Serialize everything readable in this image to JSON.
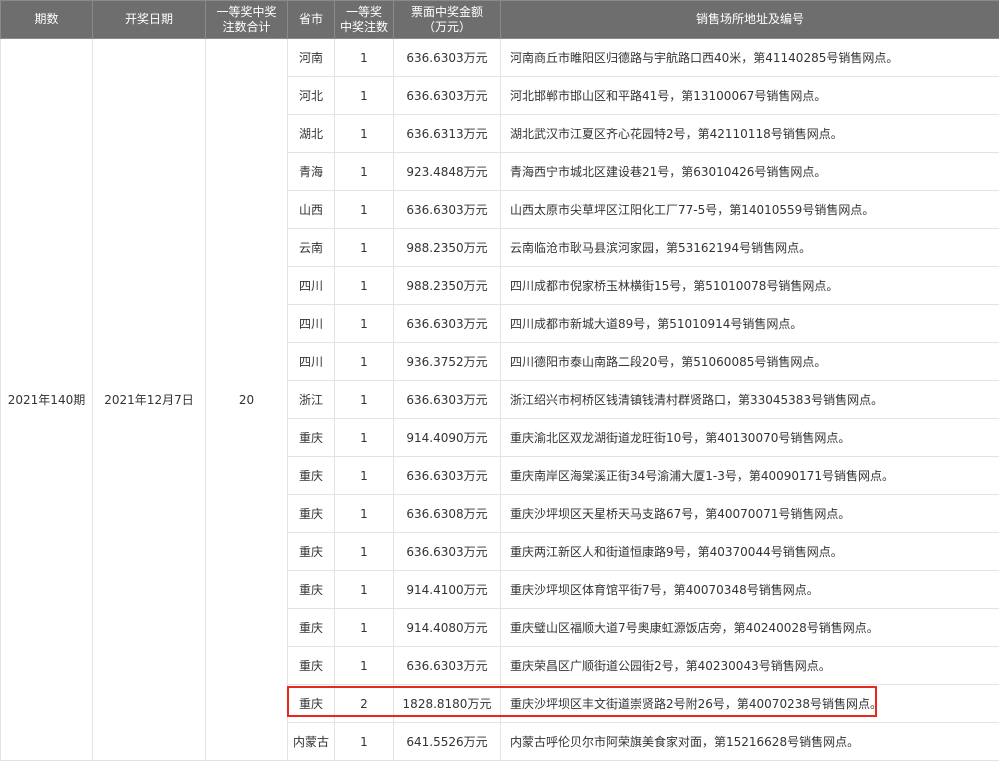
{
  "table": {
    "headers": {
      "period": "期数",
      "draw_date": "开奖日期",
      "total_first_prize_line1": "一等奖中奖",
      "total_first_prize_line2": "注数合计",
      "province": "省市",
      "first_prize_count_line1": "一等奖",
      "first_prize_count_line2": "中奖注数",
      "ticket_amount_line1": "票面中奖金额",
      "ticket_amount_line2": "（万元）",
      "address": "销售场所地址及编号"
    },
    "period": "2021年140期",
    "draw_date": "2021年12月7日",
    "total_first_prize": "20",
    "rows": [
      {
        "province": "河南",
        "count": "1",
        "amount": "636.6303万元",
        "address": "河南商丘市睢阳区归德路与宇航路口西40米，第41140285号销售网点。"
      },
      {
        "province": "河北",
        "count": "1",
        "amount": "636.6303万元",
        "address": "河北邯郸市邯山区和平路41号，第13100067号销售网点。"
      },
      {
        "province": "湖北",
        "count": "1",
        "amount": "636.6313万元",
        "address": "湖北武汉市江夏区齐心花园特2号，第42110118号销售网点。"
      },
      {
        "province": "青海",
        "count": "1",
        "amount": "923.4848万元",
        "address": "青海西宁市城北区建设巷21号，第63010426号销售网点。"
      },
      {
        "province": "山西",
        "count": "1",
        "amount": "636.6303万元",
        "address": "山西太原市尖草坪区江阳化工厂77-5号，第14010559号销售网点。"
      },
      {
        "province": "云南",
        "count": "1",
        "amount": "988.2350万元",
        "address": "云南临沧市耿马县滨河家园，第53162194号销售网点。"
      },
      {
        "province": "四川",
        "count": "1",
        "amount": "988.2350万元",
        "address": "四川成都市倪家桥玉林横街15号，第51010078号销售网点。"
      },
      {
        "province": "四川",
        "count": "1",
        "amount": "636.6303万元",
        "address": "四川成都市新城大道89号，第51010914号销售网点。"
      },
      {
        "province": "四川",
        "count": "1",
        "amount": "936.3752万元",
        "address": "四川德阳市泰山南路二段20号，第51060085号销售网点。"
      },
      {
        "province": "浙江",
        "count": "1",
        "amount": "636.6303万元",
        "address": "浙江绍兴市柯桥区钱清镇钱清村群贤路口，第33045383号销售网点。"
      },
      {
        "province": "重庆",
        "count": "1",
        "amount": "914.4090万元",
        "address": "重庆渝北区双龙湖街道龙旺街10号，第40130070号销售网点。"
      },
      {
        "province": "重庆",
        "count": "1",
        "amount": "636.6303万元",
        "address": "重庆南岸区海棠溪正街34号渝浦大厦1-3号，第40090171号销售网点。"
      },
      {
        "province": "重庆",
        "count": "1",
        "amount": "636.6308万元",
        "address": "重庆沙坪坝区天星桥天马支路67号，第40070071号销售网点。"
      },
      {
        "province": "重庆",
        "count": "1",
        "amount": "636.6303万元",
        "address": "重庆两江新区人和街道恒康路9号，第40370044号销售网点。"
      },
      {
        "province": "重庆",
        "count": "1",
        "amount": "914.4100万元",
        "address": "重庆沙坪坝区体育馆平街7号，第40070348号销售网点。"
      },
      {
        "province": "重庆",
        "count": "1",
        "amount": "914.4080万元",
        "address": "重庆璧山区福顺大道7号奥康虹源饭店旁，第40240028号销售网点。"
      },
      {
        "province": "重庆",
        "count": "1",
        "amount": "636.6303万元",
        "address": "重庆荣昌区广顺街道公园街2号，第40230043号销售网点。"
      },
      {
        "province": "重庆",
        "count": "2",
        "amount": "1828.8180万元",
        "address": "重庆沙坪坝区丰文街道崇贤路2号附26号，第40070238号销售网点。"
      },
      {
        "province": "内蒙古",
        "count": "1",
        "amount": "641.5526万元",
        "address": "内蒙古呼伦贝尔市阿荣旗美食家对面，第15216628号销售网点。"
      }
    ]
  },
  "highlight": {
    "row_index": 17,
    "color": "#e8281e"
  },
  "colors": {
    "header_bg": "#6e6e6e",
    "header_text": "#ffffff",
    "border": "#e3e3e3",
    "text": "#333333"
  }
}
